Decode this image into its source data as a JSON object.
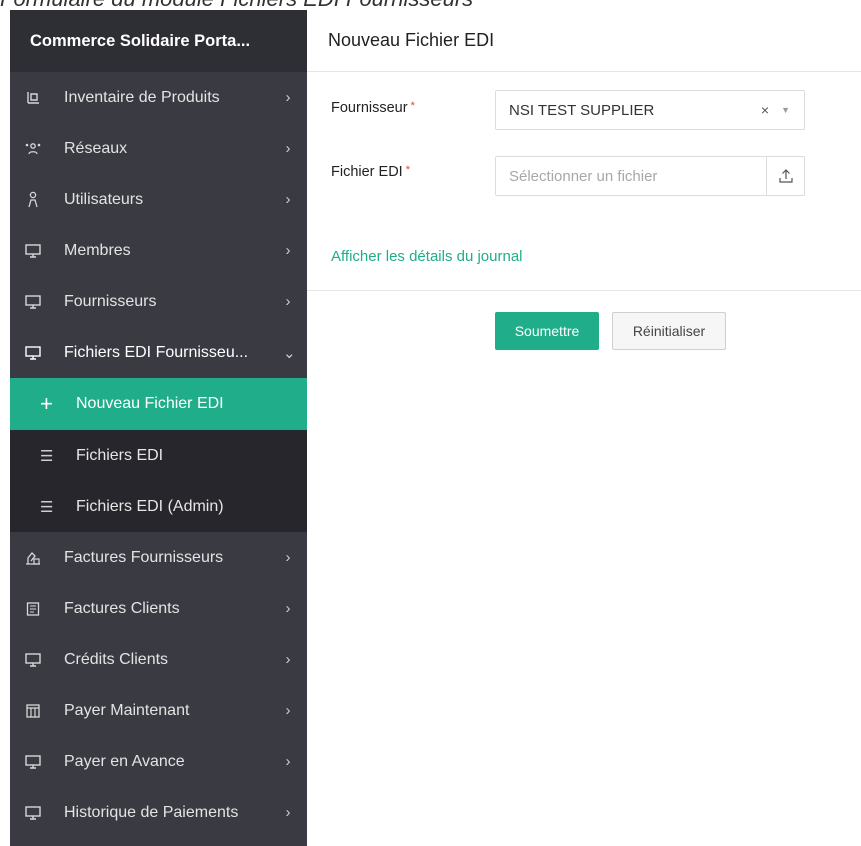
{
  "caption": "Formulaire du module Fichiers EDI Fournisseurs",
  "sidebar": {
    "title": "Commerce Solidaire Porta...",
    "items": [
      {
        "label": "Inventaire de Produits",
        "icon": "inventory-icon",
        "chevron": "›"
      },
      {
        "label": "Réseaux",
        "icon": "network-icon",
        "chevron": "›"
      },
      {
        "label": "Utilisateurs",
        "icon": "user-icon",
        "chevron": "›"
      },
      {
        "label": "Membres",
        "icon": "monitor-icon",
        "chevron": "›"
      },
      {
        "label": "Fournisseurs",
        "icon": "monitor-icon",
        "chevron": "›"
      },
      {
        "label": "Fichiers EDI Fournisseu...",
        "icon": "monitor-icon",
        "chevron": "⌄"
      }
    ],
    "subitems": [
      {
        "label": "Nouveau Fichier EDI",
        "icon": "plus-icon",
        "glyph": "+"
      },
      {
        "label": "Fichiers EDI",
        "icon": "list-icon",
        "glyph": "☰"
      },
      {
        "label": "Fichiers EDI (Admin)",
        "icon": "list-icon",
        "glyph": "☰"
      }
    ],
    "items_after": [
      {
        "label": "Factures Fournisseurs",
        "icon": "invoice-icon",
        "chevron": "›"
      },
      {
        "label": "Factures Clients",
        "icon": "receipt-icon",
        "chevron": "›"
      },
      {
        "label": "Crédits Clients",
        "icon": "monitor-icon",
        "chevron": "›"
      },
      {
        "label": "Payer Maintenant",
        "icon": "pay-icon",
        "chevron": "›"
      },
      {
        "label": "Payer en Avance",
        "icon": "monitor-icon",
        "chevron": "›"
      },
      {
        "label": "Historique de Paiements",
        "icon": "monitor-icon",
        "chevron": "›"
      }
    ]
  },
  "header": {
    "title": "Nouveau Fichier EDI"
  },
  "form": {
    "supplier_label": "Fournisseur",
    "supplier_value": "NSI TEST SUPPLIER",
    "clear_glyph": "×",
    "caret_glyph": "▼",
    "file_label": "Fichier EDI",
    "file_placeholder": "Sélectionner un fichier",
    "required_mark": "*",
    "log_link": "Afficher les détails du journal",
    "submit_label": "Soumettre",
    "reset_label": "Réinitialiser"
  },
  "colors": {
    "accent": "#20ad8a",
    "sidebar_bg": "#3a3a42",
    "sidebar_header": "#2e2e35",
    "subnav_bg": "#26262c",
    "required": "#e04444"
  }
}
